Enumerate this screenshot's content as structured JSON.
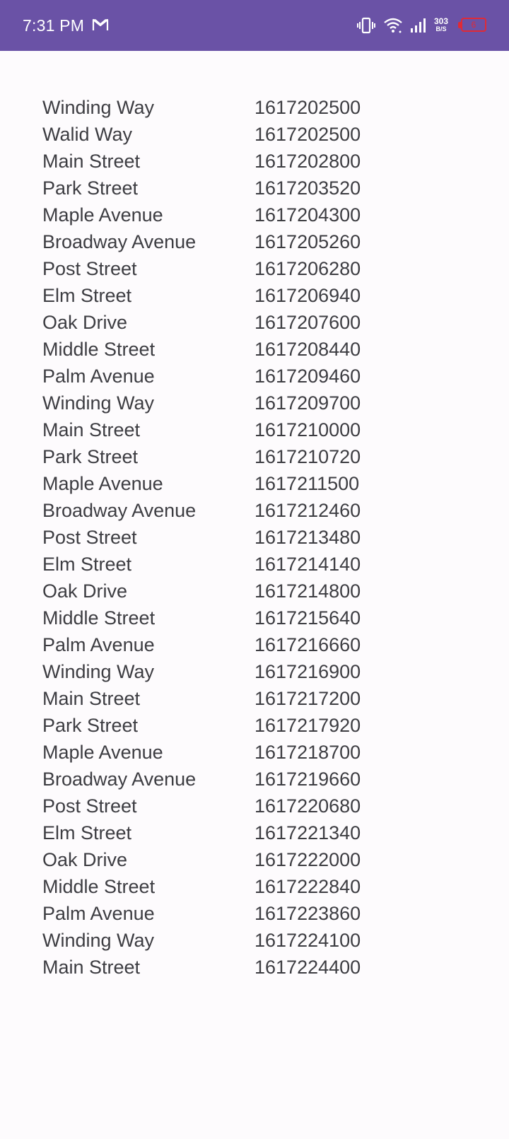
{
  "status_bar": {
    "time": "7:31 PM",
    "mail_icon": "gmail-icon",
    "net_speed_value": "303",
    "net_speed_unit": "B/S",
    "battery_level": "6",
    "colors": {
      "background": "#6a52a6",
      "battery": "#e02a36"
    }
  },
  "rows": [
    {
      "street": "Winding Way",
      "timestamp": "1617202500"
    },
    {
      "street": "Walid Way",
      "timestamp": "1617202500"
    },
    {
      "street": "Main Street",
      "timestamp": "1617202800"
    },
    {
      "street": "Park Street",
      "timestamp": "1617203520"
    },
    {
      "street": "Maple Avenue",
      "timestamp": "1617204300"
    },
    {
      "street": "Broadway Avenue",
      "timestamp": "1617205260"
    },
    {
      "street": "Post Street",
      "timestamp": "1617206280"
    },
    {
      "street": "Elm Street",
      "timestamp": "1617206940"
    },
    {
      "street": "Oak Drive",
      "timestamp": "1617207600"
    },
    {
      "street": "Middle Street",
      "timestamp": "1617208440"
    },
    {
      "street": "Palm Avenue",
      "timestamp": "1617209460"
    },
    {
      "street": "Winding Way",
      "timestamp": "1617209700"
    },
    {
      "street": "Main Street",
      "timestamp": "1617210000"
    },
    {
      "street": "Park Street",
      "timestamp": "1617210720"
    },
    {
      "street": "Maple Avenue",
      "timestamp": "1617211500"
    },
    {
      "street": "Broadway Avenue",
      "timestamp": "1617212460"
    },
    {
      "street": "Post Street",
      "timestamp": "1617213480"
    },
    {
      "street": "Elm Street",
      "timestamp": "1617214140"
    },
    {
      "street": "Oak Drive",
      "timestamp": "1617214800"
    },
    {
      "street": "Middle Street",
      "timestamp": "1617215640"
    },
    {
      "street": "Palm Avenue",
      "timestamp": "1617216660"
    },
    {
      "street": "Winding Way",
      "timestamp": "1617216900"
    },
    {
      "street": "Main Street",
      "timestamp": "1617217200"
    },
    {
      "street": "Park Street",
      "timestamp": "1617217920"
    },
    {
      "street": "Maple Avenue",
      "timestamp": "1617218700"
    },
    {
      "street": "Broadway Avenue",
      "timestamp": "1617219660"
    },
    {
      "street": "Post Street",
      "timestamp": "1617220680"
    },
    {
      "street": "Elm Street",
      "timestamp": "1617221340"
    },
    {
      "street": "Oak Drive",
      "timestamp": "1617222000"
    },
    {
      "street": "Middle Street",
      "timestamp": "1617222840"
    },
    {
      "street": "Palm Avenue",
      "timestamp": "1617223860"
    },
    {
      "street": "Winding Way",
      "timestamp": "1617224100"
    },
    {
      "street": "Main Street",
      "timestamp": "1617224400"
    }
  ]
}
